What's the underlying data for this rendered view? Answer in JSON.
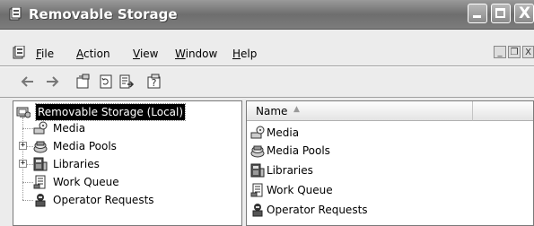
{
  "window": {
    "title": "Removable Storage",
    "controls": {
      "minimize": "minimize",
      "maximize": "maximize",
      "close": "X"
    }
  },
  "menubar": {
    "items": [
      {
        "label": "File",
        "accel": "F"
      },
      {
        "label": "Action",
        "accel": "A"
      },
      {
        "label": "View",
        "accel": "V"
      },
      {
        "label": "Window",
        "accel": "W"
      },
      {
        "label": "Help",
        "accel": "H"
      }
    ],
    "mdi_controls": {
      "minimize": "_",
      "restore": "❐",
      "close": "X"
    }
  },
  "toolbar": {
    "icons": [
      "back-arrow-icon",
      "forward-arrow-icon",
      "properties-icon",
      "refresh-icon",
      "export-list-icon",
      "help-icon"
    ]
  },
  "tree": {
    "root": {
      "label": "Removable Storage (Local)",
      "selected": true
    },
    "children": [
      {
        "label": "Media",
        "expandable": false
      },
      {
        "label": "Media Pools",
        "expandable": true
      },
      {
        "label": "Libraries",
        "expandable": true
      },
      {
        "label": "Work Queue",
        "expandable": false
      },
      {
        "label": "Operator Requests",
        "expandable": false
      }
    ]
  },
  "list": {
    "columns": [
      {
        "label": "Name",
        "sort": "ascending"
      },
      {
        "label": ""
      }
    ],
    "rows": [
      {
        "name": "Media",
        "icon": "media-icon"
      },
      {
        "name": "Media Pools",
        "icon": "media-pools-icon"
      },
      {
        "name": "Libraries",
        "icon": "libraries-icon"
      },
      {
        "name": "Work Queue",
        "icon": "work-queue-icon"
      },
      {
        "name": "Operator Requests",
        "icon": "operator-requests-icon"
      }
    ]
  },
  "colors": {
    "titlebar": "#7c7c7c",
    "selection": "#000000",
    "pane_bg": "#ffffff",
    "window_bg": "#ececec"
  }
}
